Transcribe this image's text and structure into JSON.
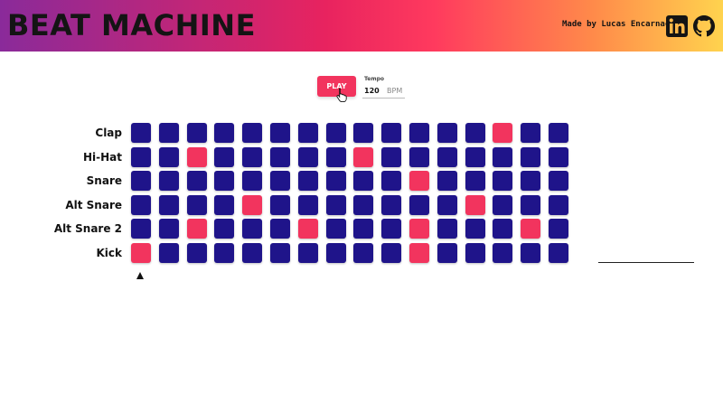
{
  "header": {
    "title": "BEAT MACHINE",
    "credit": "Made by Lucas Encarnacao",
    "links": [
      {
        "icon": "linkedin-icon"
      },
      {
        "icon": "github-icon"
      }
    ]
  },
  "controls": {
    "play_label": "PLAY",
    "tempo_label": "Tempo",
    "tempo_value": "120",
    "tempo_unit": "BPM"
  },
  "colors": {
    "pad_off": "#1f148a",
    "pad_on": "#f2345e",
    "accent": "#f2345e"
  },
  "sequencer": {
    "steps": 16,
    "current_step": 1,
    "tracks": [
      {
        "label": "Clap",
        "active": [
          14
        ]
      },
      {
        "label": "Hi-Hat",
        "active": [
          3,
          9
        ]
      },
      {
        "label": "Snare",
        "active": [
          11
        ]
      },
      {
        "label": "Alt Snare",
        "active": [
          5,
          13
        ]
      },
      {
        "label": "Alt Snare 2",
        "active": [
          3,
          7,
          11,
          15
        ]
      },
      {
        "label": "Kick",
        "active": [
          1,
          11
        ]
      }
    ]
  }
}
